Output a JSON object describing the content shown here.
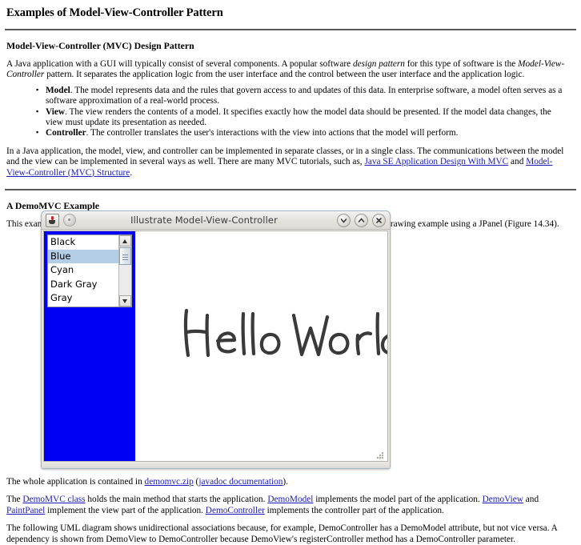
{
  "document": {
    "title": "Examples of Model-View-Controller Pattern",
    "section1_heading": "Model-View-Controller (MVC) Design Pattern",
    "intro_p1_a": "A Java application with a GUI will typically consist of several components. A popular software ",
    "intro_p1_em1": "design pattern",
    "intro_p1_b": " for this type of software is the ",
    "intro_p1_em2": "Model-View-Controller",
    "intro_p1_c": " pattern. It separates the application logic from the user interface and the control between the user interface and the application logic.",
    "bullets": [
      {
        "term": "Model",
        "text": ". The model represents data and the rules that govern access to and updates of this data. In enterprise software, a model often serves as a software approximation of a real-world process."
      },
      {
        "term": "View",
        "text": ". The view renders the contents of a model. It specifies exactly how the model data should be presented. If the model data changes, the view must update its presentation as needed."
      },
      {
        "term": "Controller",
        "text": ". The controller translates the user's interactions with the view into actions that the model will perform."
      }
    ],
    "p2_a": "In a Java application, the model, view, and controller can be implemented in separate classes, or in a single class. The communications between the model and the view can be implemented in several ways as well. There are many MVC tutorials, such as, ",
    "p2_link1": "Java SE Application Design With MVC",
    "p2_b": " and ",
    "p2_link2": "Model-View-Controller (MVC) Structure",
    "p2_c": ".",
    "section2_heading": "A DemoMVC Example",
    "p3": "This example application is a combination of the textbook's JList example (Figure 14.23) and the mouse drawing example using a JPanel (Figure 14.34).",
    "p4_a": "The whole application is contained in ",
    "p4_link1": "demomvc.zip",
    "p4_b": " (",
    "p4_link2": "javadoc documentation",
    "p4_c": ").",
    "p5_a": "The ",
    "p5_link1": "DemoMVC class",
    "p5_b": " holds the main method that starts the application. ",
    "p5_link2": "DemoModel",
    "p5_c": " implements the model part of the application. ",
    "p5_link3": "DemoView",
    "p5_d": " and ",
    "p5_link4": "PaintPanel",
    "p5_e": " implement the view part of the application. ",
    "p5_link5": "DemoController",
    "p5_f": " implements the controller part of the application.",
    "p6": "The following UML diagram shows unidirectional associations because, for example, DemoController has a DemoModel attribute, but not vice versa. A dependency is shown from DemoView to DemoController because DemoView's registerController method has a DemoController parameter."
  },
  "app_window": {
    "title": "Illustrate Model-View-Controller",
    "icons": {
      "app": "java-coffee-cup-icon",
      "menu_dot": "window-menu-icon",
      "minimize": "chevron-down-icon",
      "maximize": "chevron-up-icon",
      "close": "close-x-icon"
    },
    "color_list": {
      "items": [
        "Black",
        "Blue",
        "Cyan",
        "Dark Gray",
        "Gray"
      ],
      "selected": "Blue",
      "selected_index": 1
    },
    "paint_panel": {
      "drawing_text": "Hello World!",
      "stroke_color": "#3a3a3a"
    },
    "background_color": "#0000f5",
    "selection_color": "#b4cde6"
  },
  "colors": {
    "link": "#1a1ab8",
    "rule": "#5a5a5a",
    "blue_panel": "#0000f5",
    "title_text": "#3c3c3c"
  }
}
